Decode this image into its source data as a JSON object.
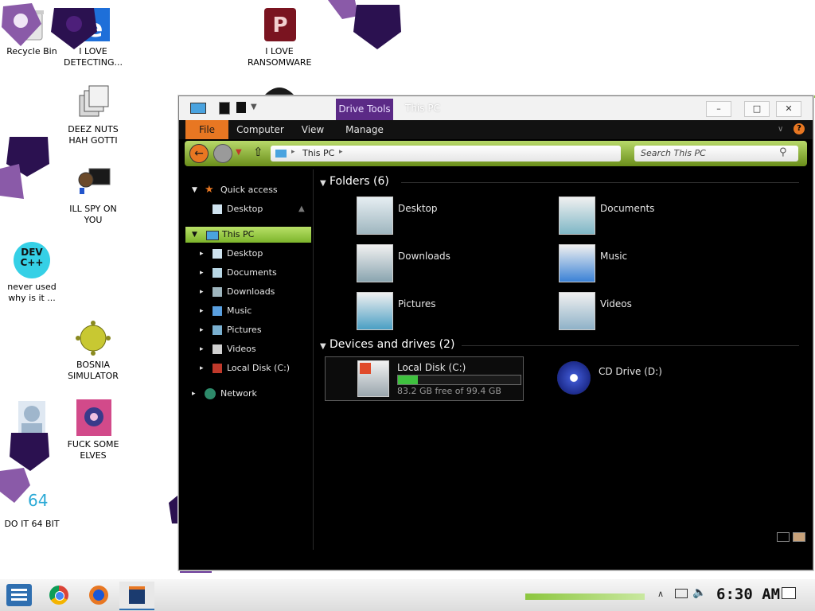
{
  "desktop": {
    "icons": [
      {
        "label": "Recycle Bin"
      },
      {
        "label": "I LOVE\nDETECTING..."
      },
      {
        "label": "I LOVE\nRANSOMWARE"
      },
      {
        "label": "DEEZ NUTS\nHAH GOTTI"
      },
      {
        "label": "ILL SPY ON\nYOU"
      },
      {
        "label": "never used\nwhy is it ..."
      },
      {
        "label": "BOSNIA\nSIMULATOR"
      },
      {
        "label": "DO"
      },
      {
        "label": "FUCK SOME\nELVES"
      },
      {
        "label": "DO IT 64 BIT"
      }
    ],
    "devcpp_text": "DEV\nC++",
    "bit_text": "64"
  },
  "window": {
    "title": "This PC",
    "context_tab": "Drive Tools",
    "controls": {
      "minimize": "–",
      "maximize": "□",
      "close": "✕"
    },
    "ribbon_tabs": [
      "File",
      "Computer",
      "View",
      "Manage"
    ],
    "address": "This PC",
    "search_placeholder": "Search This PC"
  },
  "nav": {
    "quick_access": "Quick access",
    "quick_items": [
      "Desktop"
    ],
    "this_pc": "This PC",
    "pc_items": [
      "Desktop",
      "Documents",
      "Downloads",
      "Music",
      "Pictures",
      "Videos",
      "Local Disk (C:)"
    ],
    "network": "Network"
  },
  "content": {
    "folders_header": "Folders (6)",
    "folders": [
      "Desktop",
      "Documents",
      "Downloads",
      "Music",
      "Pictures",
      "Videos"
    ],
    "devices_header": "Devices and drives (2)",
    "drives": [
      {
        "name": "Local Disk (C:)",
        "free": "83.2 GB free of 99.4 GB",
        "used_fraction": 0.163
      },
      {
        "name": "CD Drive (D:)"
      }
    ]
  },
  "taskbar": {
    "clock": "6:30 AM"
  },
  "colors": {
    "accent_green": "#8cc63f",
    "file_tab": "#e87722",
    "context_purple": "#5b2a86",
    "gem_purple": "#4d1f7a"
  }
}
